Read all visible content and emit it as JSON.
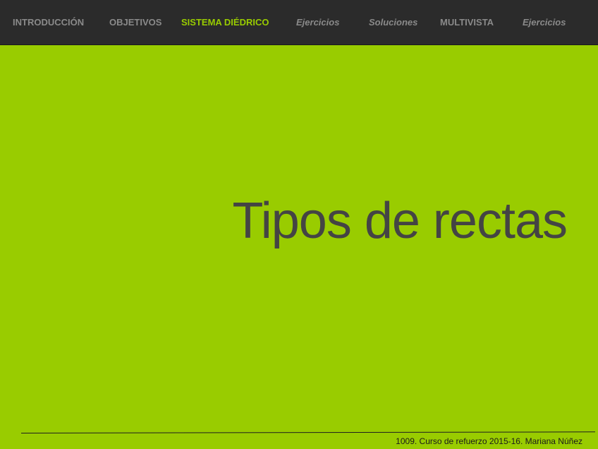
{
  "nav": {
    "items": [
      {
        "label": "INTRODUCCIÓN"
      },
      {
        "label": "OBJETIVOS"
      },
      {
        "label": "SISTEMA DIÉDRICO"
      },
      {
        "label": "Ejercicios"
      },
      {
        "label": "Soluciones"
      },
      {
        "label": "MULTIVISTA"
      },
      {
        "label": "Ejercicios"
      }
    ],
    "active_color": "#99cc00",
    "inactive_color": "#8a8a8a",
    "background": "#2b2b2b"
  },
  "slide": {
    "title": "Tipos de rectas",
    "background": "#99cc00",
    "title_color": "#444444"
  },
  "footer": {
    "text": "1009. Curso de refuerzo 2015-16. Mariana Núñez"
  }
}
